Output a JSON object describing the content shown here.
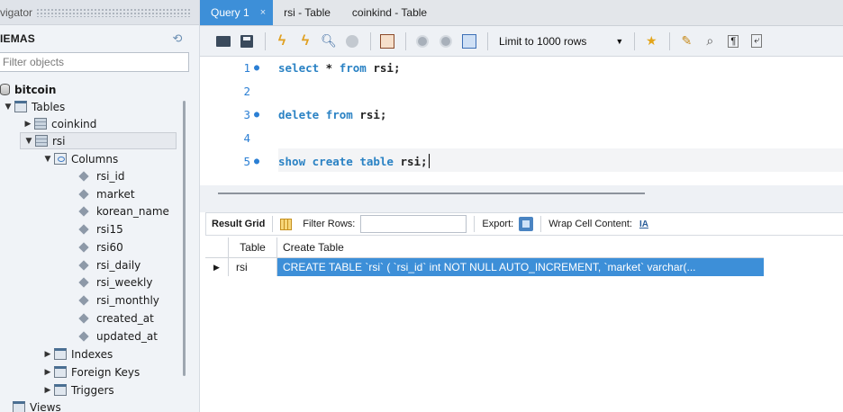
{
  "navigator": {
    "title": "vigator",
    "schemas_label": "IEMAS",
    "filter_placeholder": "Filter objects",
    "tree": {
      "database": "bitcoin",
      "tables_label": "Tables",
      "table_coinkind": "coinkind",
      "table_rsi": "rsi",
      "columns_label": "Columns",
      "columns": [
        "rsi_id",
        "market",
        "korean_name",
        "rsi15",
        "rsi60",
        "rsi_daily",
        "rsi_weekly",
        "rsi_monthly",
        "created_at",
        "updated_at"
      ],
      "indexes_label": "Indexes",
      "foreign_keys_label": "Foreign Keys",
      "triggers_label": "Triggers",
      "views_label": "Views"
    }
  },
  "tabs": [
    {
      "label": "Query 1",
      "close": "×"
    },
    {
      "label": "rsi - Table"
    },
    {
      "label": "coinkind - Table"
    }
  ],
  "toolbar": {
    "limit_label": "Limit to 1000 rows"
  },
  "editor": {
    "lines": [
      {
        "num": "1",
        "marker": "●",
        "kw": "select",
        "rest": " * ",
        "kw2": "from",
        "rest2": " rsi;"
      },
      {
        "num": "2",
        "marker": "",
        "kw": "",
        "rest": "",
        "kw2": "",
        "rest2": ""
      },
      {
        "num": "3",
        "marker": "●",
        "kw": "delete",
        "rest": " ",
        "kw2": "from",
        "rest2": " rsi;"
      },
      {
        "num": "4",
        "marker": "",
        "kw": "",
        "rest": "",
        "kw2": "",
        "rest2": ""
      },
      {
        "num": "5",
        "marker": "●",
        "kw": "show",
        "rest": " ",
        "kw2": "create table",
        "rest2": " rsi;"
      }
    ]
  },
  "result_toolbar": {
    "result_grid_label": "Result Grid",
    "filter_rows_label": "Filter Rows:",
    "export_label": "Export:",
    "wrap_label": "Wrap Cell Content:",
    "wrap_icon_text": "IA"
  },
  "grid": {
    "headers": [
      "Table",
      "Create Table"
    ],
    "rows": [
      {
        "indicator": "▶",
        "table": "rsi",
        "create_table": "CREATE TABLE `rsi` (   `rsi_id` int NOT NULL AUTO_INCREMENT,   `market` varchar(..."
      }
    ]
  }
}
